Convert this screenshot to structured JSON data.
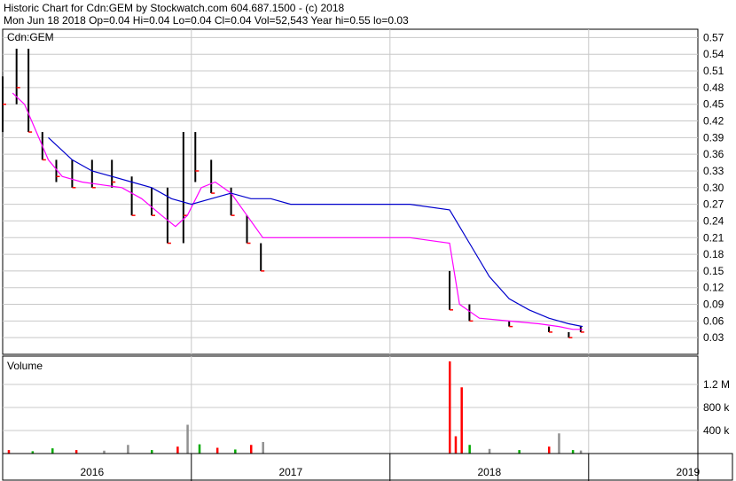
{
  "header": {
    "line1": "Historic Chart for Cdn:GEM by Stockwatch.com 604.687.1500 - (c) 2018",
    "line2": "Mon Jun 18 2018  Op=0.04  Hi=0.04  Lo=0.04  Cl=0.04  Vol=52,543  Year hi=0.55  lo=0.03"
  },
  "chart_data": [
    {
      "type": "line",
      "panel": "price",
      "title": "Cdn:GEM",
      "ylim": [
        0.0,
        0.585
      ],
      "yticks": [
        "0.57",
        "0.54",
        "0.51",
        "0.48",
        "0.45",
        "0.42",
        "0.39",
        "0.36",
        "0.33",
        "0.30",
        "0.27",
        "0.24",
        "0.21",
        "0.18",
        "0.15",
        "0.12",
        "0.09",
        "0.06",
        "0.03"
      ],
      "ytick_values": [
        0.57,
        0.54,
        0.51,
        0.48,
        0.45,
        0.42,
        0.39,
        0.36,
        0.33,
        0.3,
        0.27,
        0.24,
        0.21,
        0.18,
        0.15,
        0.12,
        0.09,
        0.06,
        0.03
      ],
      "grid": true,
      "colors": {
        "price_bar": "#000000",
        "close_down": "#ff0000",
        "ma_short": "#ff00ff",
        "ma_long": "#0000cc",
        "grid": "#c8c8c8"
      },
      "price_bars": [
        {
          "x": 2015.55,
          "hi": 0.5,
          "lo": 0.4,
          "cl": 0.45
        },
        {
          "x": 2015.62,
          "hi": 0.55,
          "lo": 0.45,
          "cl": 0.48
        },
        {
          "x": 2015.68,
          "hi": 0.55,
          "lo": 0.4,
          "cl": 0.4
        },
        {
          "x": 2015.75,
          "hi": 0.4,
          "lo": 0.35,
          "cl": 0.35
        },
        {
          "x": 2015.82,
          "hi": 0.35,
          "lo": 0.31,
          "cl": 0.32
        },
        {
          "x": 2015.9,
          "hi": 0.35,
          "lo": 0.3,
          "cl": 0.3
        },
        {
          "x": 2016.0,
          "hi": 0.35,
          "lo": 0.3,
          "cl": 0.3
        },
        {
          "x": 2016.1,
          "hi": 0.35,
          "lo": 0.3,
          "cl": 0.31
        },
        {
          "x": 2016.2,
          "hi": 0.32,
          "lo": 0.25,
          "cl": 0.25
        },
        {
          "x": 2016.3,
          "hi": 0.3,
          "lo": 0.25,
          "cl": 0.25
        },
        {
          "x": 2016.38,
          "hi": 0.3,
          "lo": 0.2,
          "cl": 0.2
        },
        {
          "x": 2016.46,
          "hi": 0.4,
          "lo": 0.2,
          "cl": 0.25
        },
        {
          "x": 2016.52,
          "hi": 0.4,
          "lo": 0.31,
          "cl": 0.33
        },
        {
          "x": 2016.6,
          "hi": 0.35,
          "lo": 0.29,
          "cl": 0.29
        },
        {
          "x": 2016.7,
          "hi": 0.3,
          "lo": 0.25,
          "cl": 0.25
        },
        {
          "x": 2016.78,
          "hi": 0.25,
          "lo": 0.2,
          "cl": 0.2
        },
        {
          "x": 2016.85,
          "hi": 0.2,
          "lo": 0.15,
          "cl": 0.15
        },
        {
          "x": 2017.8,
          "hi": 0.15,
          "lo": 0.08,
          "cl": 0.08
        },
        {
          "x": 2017.9,
          "hi": 0.09,
          "lo": 0.06,
          "cl": 0.06
        },
        {
          "x": 2018.1,
          "hi": 0.06,
          "lo": 0.05,
          "cl": 0.05
        },
        {
          "x": 2018.3,
          "hi": 0.05,
          "lo": 0.04,
          "cl": 0.04
        },
        {
          "x": 2018.4,
          "hi": 0.04,
          "lo": 0.03,
          "cl": 0.03
        },
        {
          "x": 2018.46,
          "hi": 0.05,
          "lo": 0.04,
          "cl": 0.04
        }
      ],
      "series": [
        {
          "key": "ma_short",
          "x": [
            2015.6,
            2015.66,
            2015.72,
            2015.78,
            2015.85,
            2015.95,
            2016.05,
            2016.15,
            2016.25,
            2016.35,
            2016.42,
            2016.48,
            2016.55,
            2016.62,
            2016.7,
            2016.78,
            2016.86,
            2017.0,
            2017.2,
            2017.4,
            2017.6,
            2017.8,
            2017.85,
            2017.95,
            2018.1,
            2018.25,
            2018.35,
            2018.42,
            2018.47
          ],
          "values": [
            0.47,
            0.45,
            0.4,
            0.35,
            0.32,
            0.31,
            0.305,
            0.3,
            0.28,
            0.25,
            0.23,
            0.25,
            0.3,
            0.31,
            0.29,
            0.25,
            0.21,
            0.21,
            0.21,
            0.21,
            0.21,
            0.2,
            0.09,
            0.065,
            0.06,
            0.055,
            0.05,
            0.045,
            0.045
          ]
        },
        {
          "key": "ma_long",
          "x": [
            2015.78,
            2015.9,
            2016.0,
            2016.1,
            2016.2,
            2016.3,
            2016.4,
            2016.5,
            2016.6,
            2016.7,
            2016.8,
            2016.9,
            2017.0,
            2017.2,
            2017.4,
            2017.6,
            2017.8,
            2017.9,
            2018.0,
            2018.1,
            2018.2,
            2018.3,
            2018.4,
            2018.47
          ],
          "values": [
            0.39,
            0.35,
            0.33,
            0.32,
            0.31,
            0.3,
            0.28,
            0.27,
            0.28,
            0.29,
            0.28,
            0.28,
            0.27,
            0.27,
            0.27,
            0.27,
            0.26,
            0.2,
            0.14,
            0.1,
            0.08,
            0.065,
            0.055,
            0.05
          ]
        }
      ]
    },
    {
      "type": "bar",
      "panel": "volume",
      "title": "Volume",
      "ylim": [
        0,
        1600000
      ],
      "yticks": [
        "1.2 M",
        "800 k",
        "400 k"
      ],
      "ytick_values": [
        1200000,
        800000,
        400000
      ],
      "grid": true,
      "colors": {
        "up": "#00aa00",
        "down": "#ff0000",
        "unchanged": "#909090"
      },
      "bars": [
        {
          "x": 2015.58,
          "v": 60000,
          "c": "down"
        },
        {
          "x": 2015.7,
          "v": 40000,
          "c": "up"
        },
        {
          "x": 2015.8,
          "v": 90000,
          "c": "up"
        },
        {
          "x": 2015.92,
          "v": 60000,
          "c": "down"
        },
        {
          "x": 2016.06,
          "v": 50000,
          "c": "unchanged"
        },
        {
          "x": 2016.18,
          "v": 150000,
          "c": "unchanged"
        },
        {
          "x": 2016.3,
          "v": 60000,
          "c": "up"
        },
        {
          "x": 2016.43,
          "v": 120000,
          "c": "down"
        },
        {
          "x": 2016.48,
          "v": 500000,
          "c": "unchanged"
        },
        {
          "x": 2016.54,
          "v": 160000,
          "c": "up"
        },
        {
          "x": 2016.63,
          "v": 100000,
          "c": "down"
        },
        {
          "x": 2016.72,
          "v": 70000,
          "c": "up"
        },
        {
          "x": 2016.8,
          "v": 150000,
          "c": "down"
        },
        {
          "x": 2016.86,
          "v": 200000,
          "c": "unchanged"
        },
        {
          "x": 2017.8,
          "v": 1600000,
          "c": "down"
        },
        {
          "x": 2017.83,
          "v": 300000,
          "c": "down"
        },
        {
          "x": 2017.86,
          "v": 1150000,
          "c": "down"
        },
        {
          "x": 2017.9,
          "v": 150000,
          "c": "up"
        },
        {
          "x": 2018.0,
          "v": 80000,
          "c": "unchanged"
        },
        {
          "x": 2018.15,
          "v": 60000,
          "c": "up"
        },
        {
          "x": 2018.3,
          "v": 120000,
          "c": "down"
        },
        {
          "x": 2018.35,
          "v": 350000,
          "c": "unchanged"
        },
        {
          "x": 2018.42,
          "v": 60000,
          "c": "up"
        },
        {
          "x": 2018.46,
          "v": 52543,
          "c": "unchanged"
        }
      ]
    }
  ],
  "x_axis": {
    "xlim": [
      2015.55,
      2019.05
    ],
    "year_labels": [
      {
        "label": "2016",
        "center": 2016.0
      },
      {
        "label": "2017",
        "center": 2017.0
      },
      {
        "label": "2018",
        "center": 2018.0
      },
      {
        "label": "2019",
        "center": 2019.0
      }
    ],
    "year_boundaries": [
      2016.5,
      2017.5,
      2018.5
    ]
  }
}
